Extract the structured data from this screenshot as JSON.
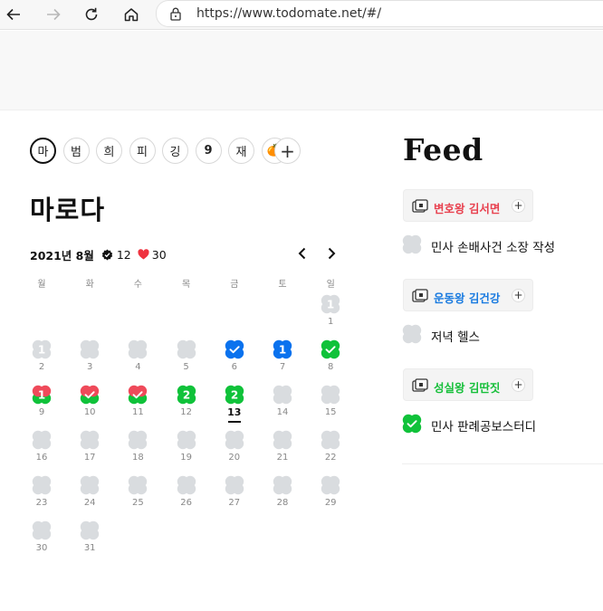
{
  "browser": {
    "url": "https://www.todomate.net/#/"
  },
  "profiles": [
    {
      "label": "마",
      "active": true
    },
    {
      "label": "범"
    },
    {
      "label": "희"
    },
    {
      "label": "피"
    },
    {
      "label": "깅"
    },
    {
      "label": "9",
      "bold": true
    },
    {
      "label": "재"
    },
    {
      "label": "🍊"
    }
  ],
  "add_profile_label": "+",
  "user_name": "마로다",
  "calendar": {
    "month_label": "2021년 8월",
    "checks_count": "12",
    "hearts_count": "30",
    "weekdays": [
      "월",
      "화",
      "수",
      "목",
      "금",
      "토",
      "일"
    ],
    "first_weekday_index": 6,
    "today": 13,
    "days": [
      {
        "day": 1,
        "state": "grey",
        "count": "1"
      },
      {
        "day": 2,
        "state": "grey",
        "count": "1"
      },
      {
        "day": 3,
        "state": "grey"
      },
      {
        "day": 4,
        "state": "grey"
      },
      {
        "day": 5,
        "state": "grey"
      },
      {
        "day": 6,
        "state": "blue",
        "check": true
      },
      {
        "day": 7,
        "state": "blue",
        "count": "1"
      },
      {
        "day": 8,
        "state": "green",
        "check": true
      },
      {
        "day": 9,
        "state": "heart-green",
        "count": "1"
      },
      {
        "day": 10,
        "state": "heart-green",
        "check": true
      },
      {
        "day": 11,
        "state": "heart-green",
        "check": true
      },
      {
        "day": 12,
        "state": "green",
        "count": "2"
      },
      {
        "day": 13,
        "state": "green",
        "count": "2"
      },
      {
        "day": 14,
        "state": "grey"
      },
      {
        "day": 15,
        "state": "grey"
      },
      {
        "day": 16,
        "state": "grey"
      },
      {
        "day": 17,
        "state": "grey"
      },
      {
        "day": 18,
        "state": "grey"
      },
      {
        "day": 19,
        "state": "grey"
      },
      {
        "day": 20,
        "state": "grey"
      },
      {
        "day": 21,
        "state": "grey"
      },
      {
        "day": 22,
        "state": "grey"
      },
      {
        "day": 23,
        "state": "grey"
      },
      {
        "day": 24,
        "state": "grey"
      },
      {
        "day": 25,
        "state": "grey"
      },
      {
        "day": 26,
        "state": "grey"
      },
      {
        "day": 27,
        "state": "grey"
      },
      {
        "day": 28,
        "state": "grey"
      },
      {
        "day": 29,
        "state": "grey"
      },
      {
        "day": 30,
        "state": "grey"
      },
      {
        "day": 31,
        "state": "grey"
      }
    ]
  },
  "feed": {
    "title": "Feed",
    "groups": [
      {
        "name": "변호왕 김서면",
        "color": "#e8414f",
        "task": "민사 손배사건 소장 작성",
        "done": false
      },
      {
        "name": "운동왕 김건강",
        "color": "#1a7be0",
        "task": "저녁 헬스",
        "done": false
      },
      {
        "name": "성실왕 김딴짓",
        "color": "#16bf3a",
        "task": "민사 판례공보스터디",
        "done": true
      }
    ],
    "add_label": "+"
  },
  "colors": {
    "grey": "#d9dcdf",
    "blue": "#0a72ee",
    "green": "#10c23a",
    "heart": "#ef4a5a"
  }
}
